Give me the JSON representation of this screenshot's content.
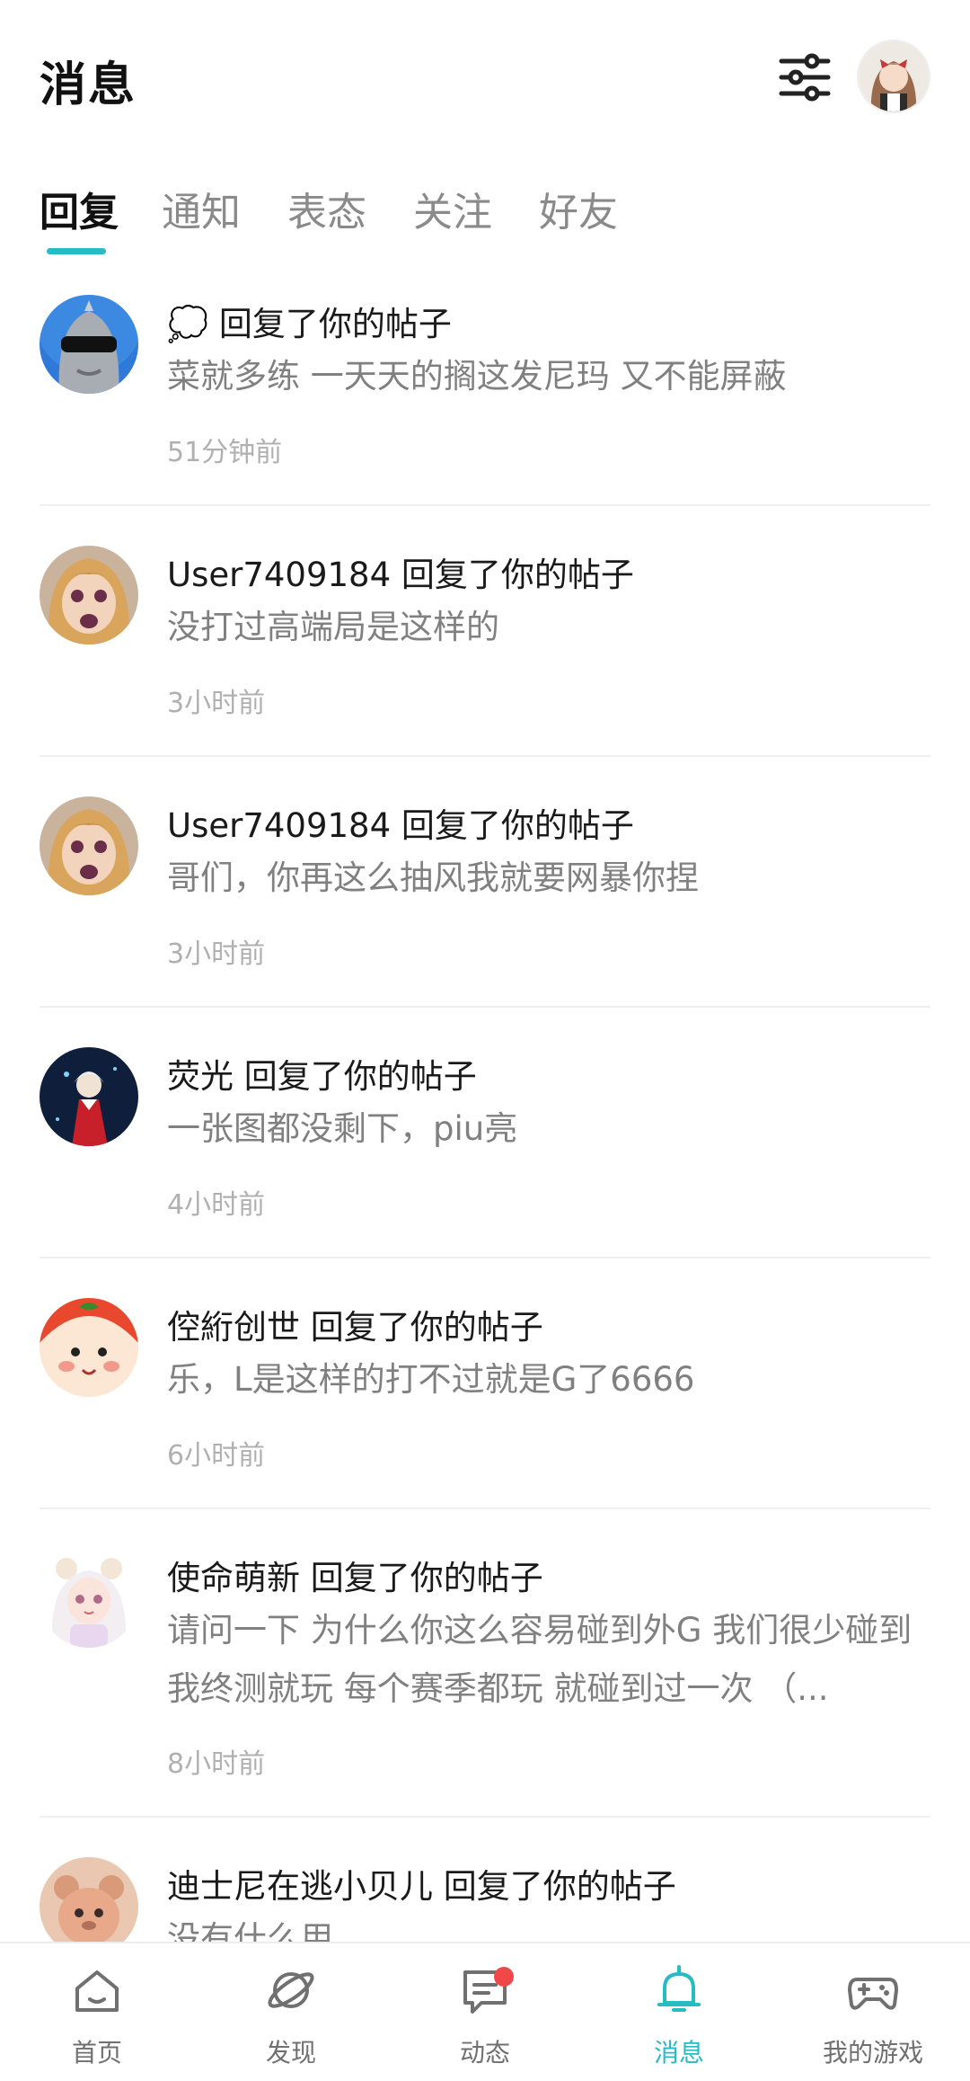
{
  "header": {
    "title": "消息"
  },
  "tabs": [
    {
      "label": "回复",
      "active": true
    },
    {
      "label": "通知",
      "active": false
    },
    {
      "label": "表态",
      "active": false
    },
    {
      "label": "关注",
      "active": false
    },
    {
      "label": "好友",
      "active": false
    }
  ],
  "messages": [
    {
      "sender": "💭",
      "action": "回复了你的帖子",
      "content": "菜就多练   一天天的搁这发尼玛  又不能屏蔽",
      "time": "51分钟前",
      "avatar": "sunglasses-hero-avatar"
    },
    {
      "sender": "User7409184",
      "action": "回复了你的帖子",
      "content": "没打过高端局是这样的",
      "time": "3小时前",
      "avatar": "anime-shocked-girl-avatar"
    },
    {
      "sender": "User7409184",
      "action": "回复了你的帖子",
      "content": "哥们，你再这么抽风我就要网暴你捏",
      "time": "3小时前",
      "avatar": "anime-shocked-girl-avatar"
    },
    {
      "sender": "荧光",
      "action": "回复了你的帖子",
      "content": "一张图都没剩下，piu亮",
      "time": "4小时前",
      "avatar": "anime-red-dress-avatar"
    },
    {
      "sender": "倥絎创世",
      "action": "回复了你的帖子",
      "content": "乐，L是这样的打不过就是G了6666",
      "time": "6小时前",
      "avatar": "cartoon-face-avatar"
    },
    {
      "sender": "使命萌新",
      "action": "回复了你的帖子",
      "content": "请问一下 为什么你这么容易碰到外G 我们很少碰到 我终测就玩 每个赛季都玩 就碰到过一次 （...",
      "time": "8小时前",
      "avatar": "anime-bear-ears-girl-avatar"
    },
    {
      "sender": "迪士尼在逃小贝儿",
      "action": "回复了你的帖子",
      "content": "没有什么用",
      "time": "",
      "avatar": "plush-bear-avatar"
    }
  ],
  "tabbar": [
    {
      "label": "首页",
      "icon": "home-icon",
      "active": false
    },
    {
      "label": "发现",
      "icon": "planet-icon",
      "active": false
    },
    {
      "label": "动态",
      "icon": "chat-bubble-icon",
      "active": false
    },
    {
      "label": "消息",
      "icon": "bell-icon",
      "active": true
    },
    {
      "label": "我的游戏",
      "icon": "gamepad-icon",
      "active": false
    }
  ],
  "colors": {
    "accent": "#27bcc4",
    "badge": "#f04848"
  }
}
